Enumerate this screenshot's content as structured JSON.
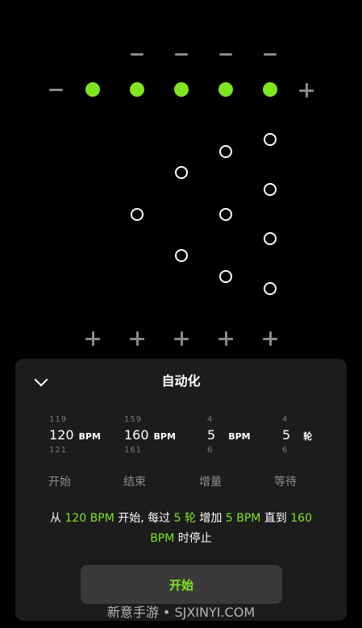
{
  "panel": {
    "title": "自动化",
    "columns": [
      {
        "prev": "119",
        "value": "120",
        "unit": "BPM",
        "next": "121",
        "label": "开始"
      },
      {
        "prev": "159",
        "value": "160",
        "unit": "BPM",
        "next": "161",
        "label": "结束"
      },
      {
        "prev": "4",
        "value": "5",
        "unit": "BPM",
        "next": "6",
        "label": "增量"
      },
      {
        "prev": "4",
        "value": "5",
        "unit": "轮",
        "next": "6",
        "label": "等待"
      }
    ],
    "summary": {
      "p1": "从 ",
      "start_bpm": "120 BPM",
      "p2": " 开始, 每过 ",
      "rounds": "5 轮",
      "p3": " 增加 ",
      "inc": "5 BPM",
      "p4": " 直到 ",
      "end_bpm": "160 BPM",
      "p5": " 时停止"
    },
    "start_button": "开始"
  },
  "watermark": "新意手游 • SJXINYI.COM",
  "colors": {
    "accent": "#7ee61a",
    "panel": "#1c1c1c",
    "button": "#3a3a3a"
  }
}
